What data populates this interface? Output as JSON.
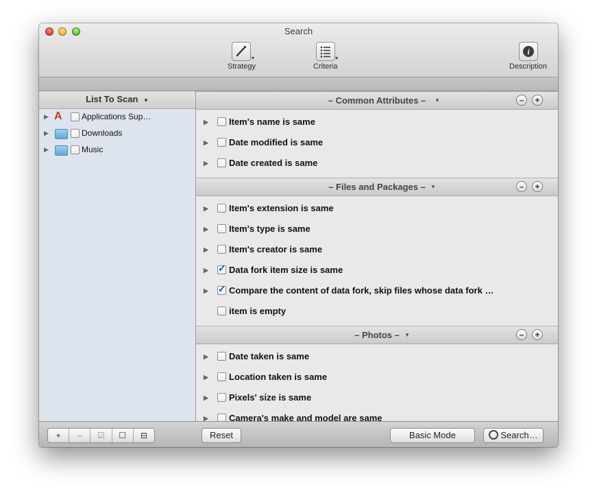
{
  "window": {
    "title": "Search"
  },
  "toolbar": {
    "strategy_label": "Strategy",
    "criteria_label": "Criteria",
    "description_label": "Description"
  },
  "left_pane": {
    "header": "List To Scan",
    "items": [
      {
        "label": "Applications Sup…",
        "icon": "applications-folder-icon",
        "checked": false
      },
      {
        "label": "Downloads",
        "icon": "downloads-folder-icon",
        "checked": false
      },
      {
        "label": "Music",
        "icon": "music-folder-icon",
        "checked": false
      }
    ]
  },
  "sections": [
    {
      "title": "– Common Attributes –",
      "rules": [
        {
          "label": "Item's name is same",
          "checked": false,
          "expandable": true
        },
        {
          "label": "Date modified is same",
          "checked": false,
          "expandable": true
        },
        {
          "label": "Date created is same",
          "checked": false,
          "expandable": true
        }
      ]
    },
    {
      "title": "– Files and Packages –",
      "rules": [
        {
          "label": "Item's extension is same",
          "checked": false,
          "expandable": true
        },
        {
          "label": "Item's type is same",
          "checked": false,
          "expandable": true
        },
        {
          "label": "Item's creator is same",
          "checked": false,
          "expandable": true
        },
        {
          "label": "Data fork item size is same",
          "checked": true,
          "expandable": true
        },
        {
          "label": "Compare the content of data fork, skip files whose data fork …",
          "checked": true,
          "expandable": true
        },
        {
          "label": "item is empty",
          "checked": false,
          "expandable": false
        }
      ]
    },
    {
      "title": "– Photos –",
      "rules": [
        {
          "label": "Date taken is same",
          "checked": false,
          "expandable": true
        },
        {
          "label": "Location taken is same",
          "checked": false,
          "expandable": true
        },
        {
          "label": "Pixels' size is same",
          "checked": false,
          "expandable": true
        },
        {
          "label": "Camera's make and model are same",
          "checked": false,
          "expandable": true
        }
      ]
    }
  ],
  "bottom": {
    "segment_labels": [
      "+",
      "–",
      "☑",
      "☐",
      "⊟"
    ],
    "reset_label": "Reset",
    "basic_mode_label": "Basic Mode",
    "search_label": "Search…"
  },
  "colors": {
    "check_accent": "#1b4f9c",
    "sidebar_bg": "#dee4ed"
  }
}
